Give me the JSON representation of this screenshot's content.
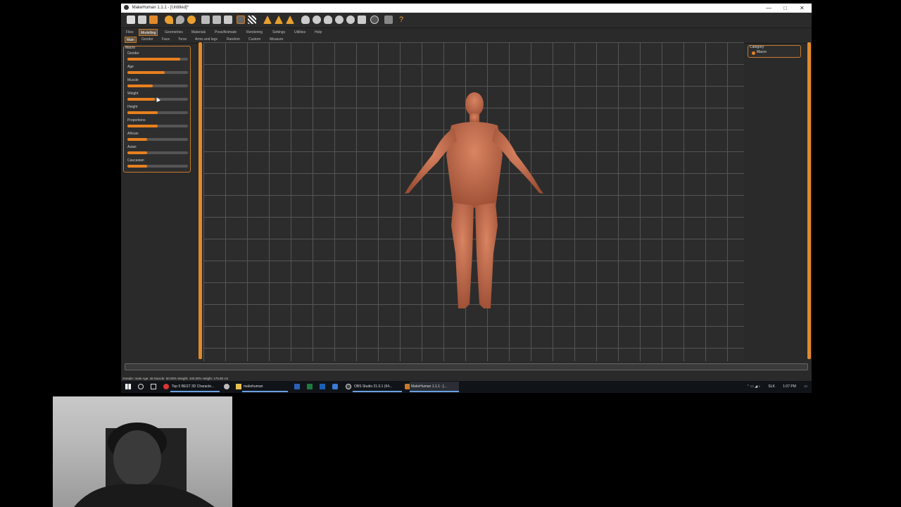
{
  "window": {
    "title": "MakeHuman 1.1.1 - [Untitled]*",
    "controls": [
      "—",
      "□",
      "✕"
    ]
  },
  "menu_tabs": [
    {
      "label": "Files",
      "active": false
    },
    {
      "label": "Modelling",
      "active": true
    },
    {
      "label": "Geometries",
      "active": false
    },
    {
      "label": "Materials",
      "active": false
    },
    {
      "label": "Pose/Animate",
      "active": false
    },
    {
      "label": "Rendering",
      "active": false
    },
    {
      "label": "Settings",
      "active": false
    },
    {
      "label": "Utilities",
      "active": false
    },
    {
      "label": "Help",
      "active": false
    }
  ],
  "sub_tabs": [
    {
      "label": "Main",
      "active": true
    },
    {
      "label": "Gender",
      "active": false
    },
    {
      "label": "Face",
      "active": false
    },
    {
      "label": "Torso",
      "active": false
    },
    {
      "label": "Arms and legs",
      "active": false
    },
    {
      "label": "Random",
      "active": false
    },
    {
      "label": "Custom",
      "active": false
    },
    {
      "label": "Measure",
      "active": false
    }
  ],
  "left_panel": {
    "title": "Macro",
    "sliders": [
      {
        "label": "Gender",
        "value": 0.87
      },
      {
        "label": "Age",
        "value": 0.62
      },
      {
        "label": "Muscle",
        "value": 0.42
      },
      {
        "label": "Weight",
        "value": 0.45
      },
      {
        "label": "Height",
        "value": 0.5
      },
      {
        "label": "Proportions",
        "value": 0.5
      },
      {
        "label": "African",
        "value": 0.33
      },
      {
        "label": "Asian",
        "value": 0.33
      },
      {
        "label": "Caucasian",
        "value": 0.33
      }
    ]
  },
  "right_panel": {
    "title": "Category",
    "option": "Macro"
  },
  "status_text": "Gender: male Age: 46 Muscle: 50.00% Weight: 100.00% Height: 175.90 cm",
  "taskbar": {
    "tasks": [
      "Top 5 BEST 3D Characte...",
      "makehuman",
      "OBS Studio 21.0.1 (64...",
      "MakeHuman 1.1.1 - [..."
    ],
    "tray_lang": "SLK",
    "tray_time": "1:07 PM"
  },
  "colors": {
    "accent": "#e8801e",
    "skin": "#c76a4a",
    "viewport_bg": "#2c2c2c"
  }
}
